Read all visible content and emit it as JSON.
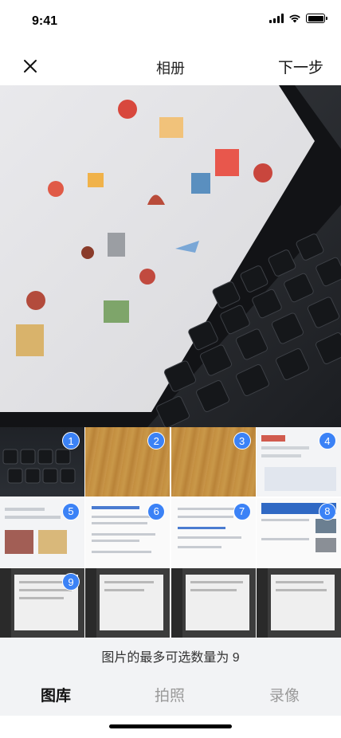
{
  "status_bar": {
    "time": "9:41"
  },
  "nav": {
    "title": "相册",
    "next_label": "下一步"
  },
  "grid": {
    "badges": [
      "1",
      "2",
      "3",
      "4",
      "5",
      "6",
      "7",
      "8",
      "9"
    ]
  },
  "hint": "图片的最多可选数量为 9",
  "tabs": {
    "library": "图库",
    "photo": "拍照",
    "video": "录像"
  },
  "colors": {
    "badge": "#3b82f6",
    "tab_active": "#111111",
    "tab_inactive": "#9a9a9a"
  }
}
